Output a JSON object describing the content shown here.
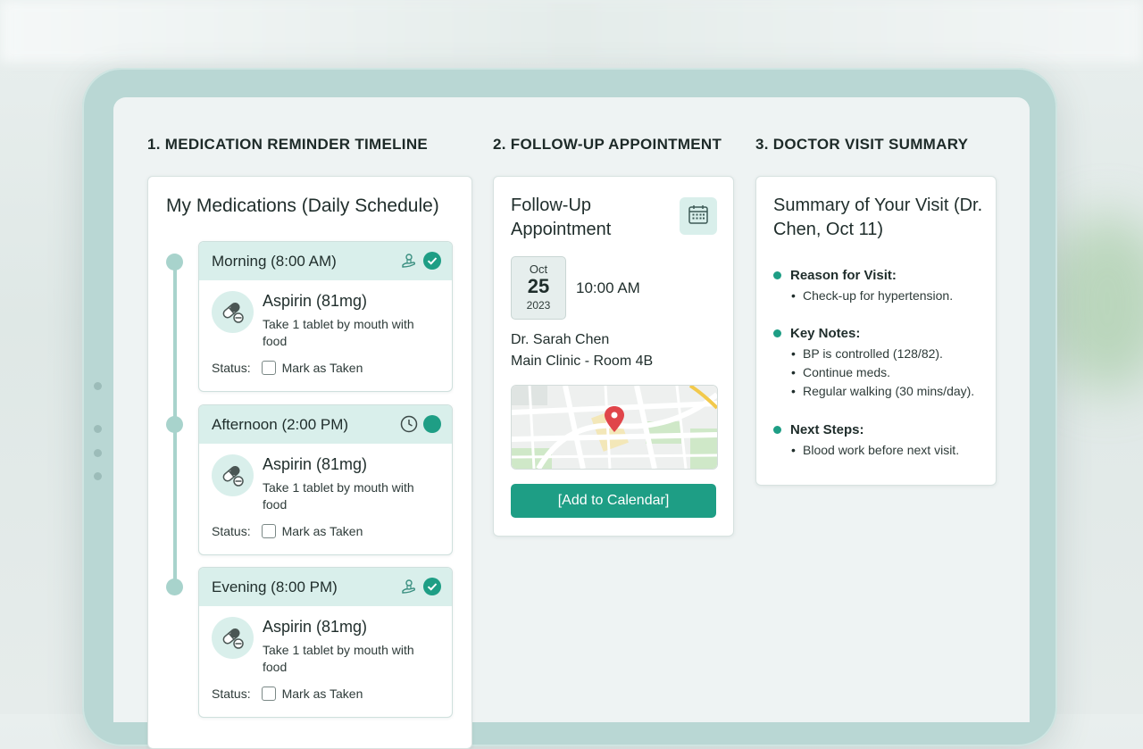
{
  "sections": {
    "medication": "1. MEDICATION REMINDER TIMELINE",
    "appointment": "2. FOLLOW-UP APPOINTMENT",
    "summary": "3. DOCTOR VISIT SUMMARY"
  },
  "medications": {
    "title": "My Medications (Daily Schedule)",
    "slots": [
      {
        "label": "Morning (8:00 AM)",
        "icons": [
          "food-hand-icon",
          "check-circle-icon"
        ],
        "drug": "Aspirin (81mg)",
        "instructions": "Take 1 tablet by mouth with food",
        "status_label": "Status:",
        "action_label": "Mark as Taken"
      },
      {
        "label": "Afternoon (2:00 PM)",
        "icons": [
          "clock-icon",
          "status-dot-icon"
        ],
        "drug": "Aspirin (81mg)",
        "instructions": "Take 1 tablet by mouth with food",
        "status_label": "Status:",
        "action_label": "Mark as Taken"
      },
      {
        "label": "Evening (8:00 PM)",
        "icons": [
          "food-hand-icon",
          "check-circle-icon"
        ],
        "drug": "Aspirin (81mg)",
        "instructions": "Take 1 tablet by mouth with food",
        "status_label": "Status:",
        "action_label": "Mark as Taken"
      }
    ]
  },
  "appointment": {
    "title": "Follow-Up Appointment",
    "month": "Oct",
    "day": "25",
    "year": "2023",
    "time": "10:00 AM",
    "doctor": "Dr. Sarah Chen",
    "location": "Main Clinic - Room 4B",
    "button_label": "[Add to Calendar]"
  },
  "summary": {
    "title": "Summary of Your Visit (Dr. Chen, Oct 11)",
    "sections": [
      {
        "heading": "Reason for Visit:",
        "items": [
          "Check-up for hypertension."
        ]
      },
      {
        "heading": "Key Notes:",
        "items": [
          "BP is controlled (128/82).",
          "Continue meds.",
          "Regular walking (30 mins/day)."
        ]
      },
      {
        "heading": "Next Steps:",
        "items": [
          "Blood work before next visit."
        ]
      }
    ]
  },
  "colors": {
    "accent": "#1e9e85",
    "accent_light": "#d9efeb",
    "timeline": "#a8d3cc",
    "map_pin": "#e0454a"
  }
}
